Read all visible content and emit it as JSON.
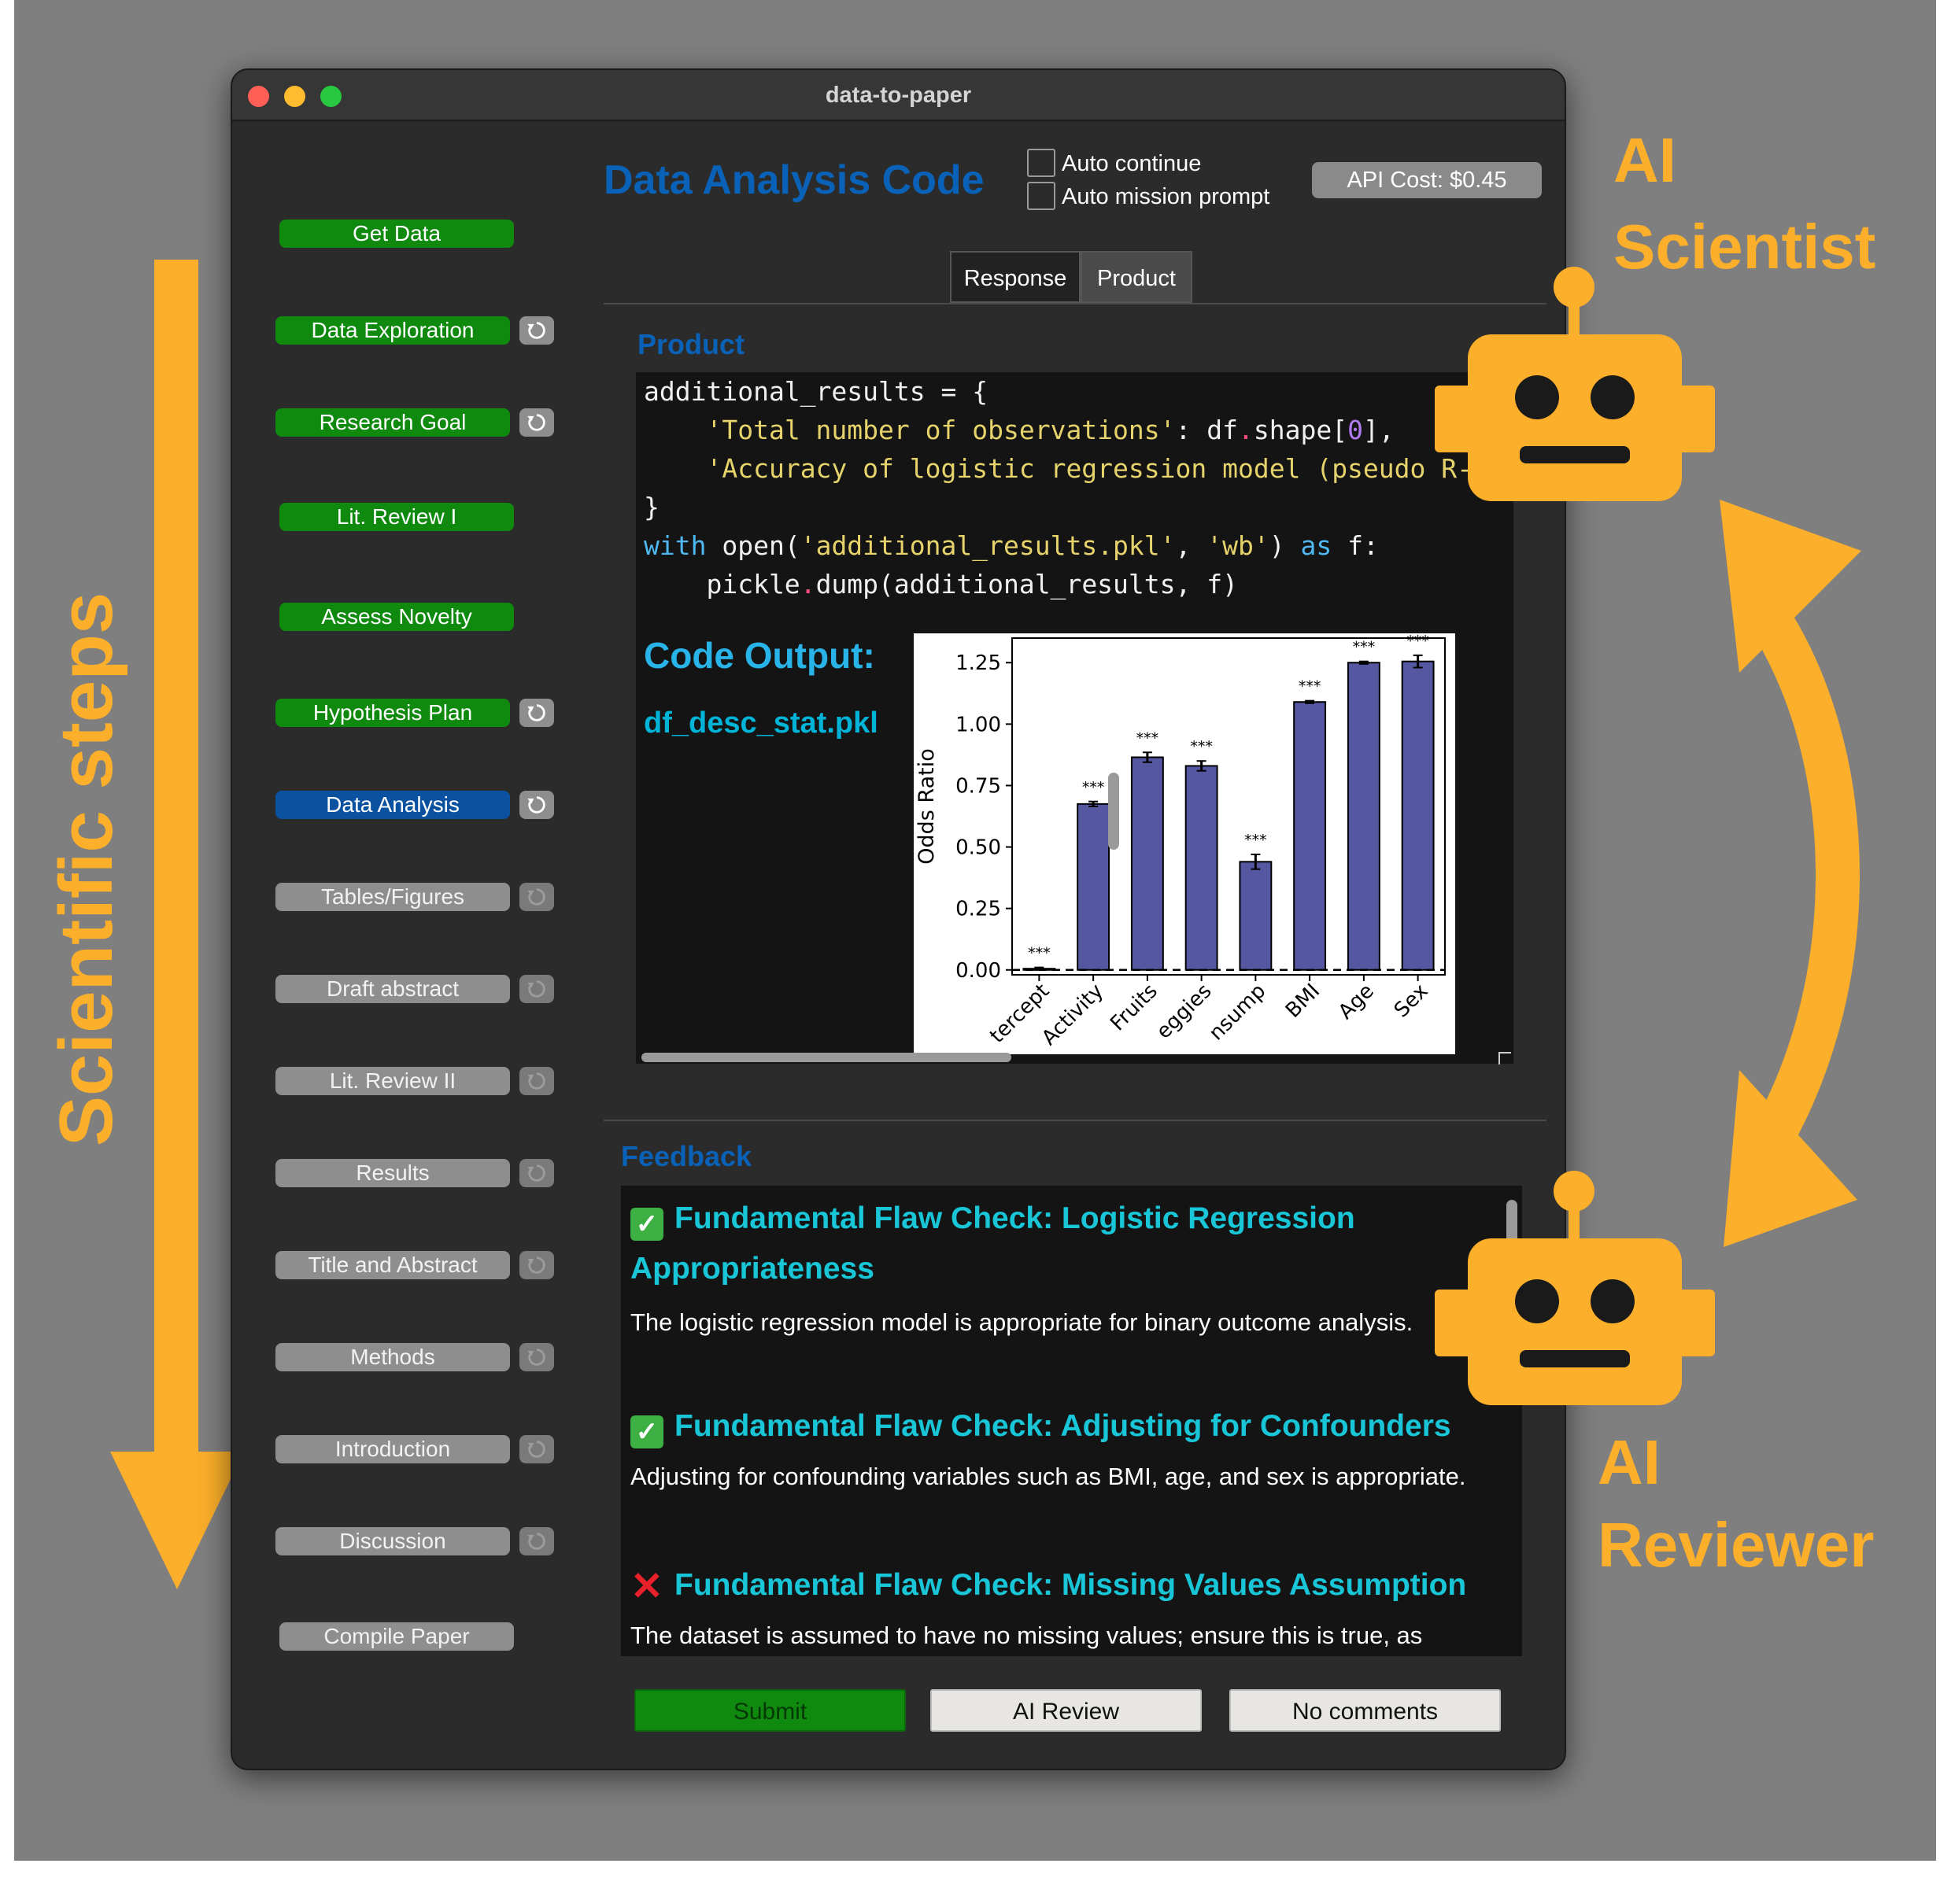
{
  "window": {
    "title": "data-to-paper"
  },
  "sidebar": {
    "steps": [
      {
        "label": "Get Data",
        "state": "done"
      },
      {
        "label": "Data Exploration",
        "state": "done"
      },
      {
        "label": "Research Goal",
        "state": "done"
      },
      {
        "label": "Lit. Review I",
        "state": "done"
      },
      {
        "label": "Assess Novelty",
        "state": "done"
      },
      {
        "label": "Hypothesis  Plan",
        "state": "done"
      },
      {
        "label": "Data Analysis",
        "state": "active"
      },
      {
        "label": "Tables/Figures",
        "state": "pending"
      },
      {
        "label": "Draft abstract",
        "state": "pending"
      },
      {
        "label": "Lit. Review II",
        "state": "pending"
      },
      {
        "label": "Results",
        "state": "pending"
      },
      {
        "label": "Title and Abstract",
        "state": "pending"
      },
      {
        "label": "Methods",
        "state": "pending"
      },
      {
        "label": "Introduction",
        "state": "pending"
      },
      {
        "label": "Discussion",
        "state": "pending"
      },
      {
        "label": "Compile Paper",
        "state": "pending"
      }
    ],
    "reset_icon": "reset-icon"
  },
  "header": {
    "title": "Data Analysis Code",
    "auto_continue": {
      "label": "Auto continue",
      "checked": false
    },
    "auto_mission": {
      "label": "Auto mission prompt",
      "checked": false
    },
    "api_cost": "API Cost: $0.45"
  },
  "tabs": {
    "response": "Response",
    "product": "Product"
  },
  "product": {
    "section_label": "Product",
    "code_lines": [
      "additional_results = {",
      "    'Total number of observations': df.shape[0],",
      "    'Accuracy of logistic regression model (pseudo R-sq",
      "}",
      "with open('additional_results.pkl', 'wb') as f:",
      "    pickle.dump(additional_results, f)"
    ],
    "code_output_title": "Code Output:",
    "output_file": "df_desc_stat.pkl"
  },
  "chart_data": {
    "type": "bar",
    "categories": [
      "Intercept",
      "Activity",
      "Fruits",
      "Veggies",
      "Consump",
      "BMI",
      "Age",
      "Sex"
    ],
    "category_labels_shown": [
      "tercept",
      "Activity",
      "Fruits",
      "eggies",
      "nsump",
      "BMI",
      "Age",
      "Sex"
    ],
    "values": [
      0.005,
      0.675,
      0.865,
      0.83,
      0.44,
      1.09,
      1.25,
      1.255
    ],
    "errors": [
      0.005,
      0.01,
      0.02,
      0.02,
      0.03,
      0.005,
      0.005,
      0.025
    ],
    "significance": [
      "***",
      "***",
      "***",
      "***",
      "***",
      "***",
      "***",
      "***"
    ],
    "ylabel": "Odds Ratio",
    "yticks": [
      "0.00",
      "0.25",
      "0.50",
      "0.75",
      "1.00",
      "1.25"
    ],
    "ylim": [
      -0.02,
      1.35
    ],
    "reference_line": 0.0,
    "bar_color": "#5558a0"
  },
  "feedback": {
    "section_label": "Feedback",
    "items": [
      {
        "status": "ok",
        "icon": "check-icon",
        "title": "Fundamental Flaw Check: Logistic Regression Appropriateness",
        "body": "The logistic regression model is appropriate for binary outcome analysis."
      },
      {
        "status": "ok",
        "icon": "check-icon",
        "title": "Fundamental Flaw Check: Adjusting for Confounders",
        "body": "Adjusting for confounding variables such as BMI, age, and sex is appropriate."
      },
      {
        "status": "bad",
        "icon": "cross-icon",
        "title": "Fundamental Flaw Check: Missing Values Assumption",
        "body": "The dataset is assumed to have no missing values; ensure this is true, as"
      }
    ]
  },
  "buttons": {
    "submit": "Submit",
    "ai_review": "AI Review",
    "no_comments": "No comments"
  },
  "annotations": {
    "ai_scientist_line1": "AI",
    "ai_scientist_line2": "Scientist",
    "ai_reviewer_line1": "AI",
    "ai_reviewer_line2": "Reviewer",
    "scientific_steps": "Scientific steps",
    "accent_color": "#fbaf2a"
  }
}
